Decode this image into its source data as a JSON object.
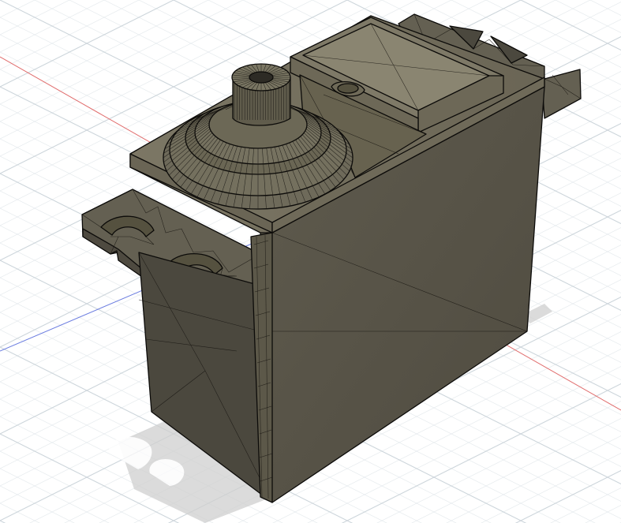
{
  "viewport": {
    "background": "#ffffff",
    "grid_minor_color": "#dde3e8",
    "grid_major_color": "#c9d1d8",
    "x_axis_color": "#e06b6b",
    "z_axis_color": "#6b7de0"
  },
  "model": {
    "name": "servo-motor-body",
    "display_mode": "shaded-with-visible-edges",
    "face_colors": {
      "top": "#75705f",
      "front": "#5a564a",
      "left": "#4b483e",
      "flange": "#646052",
      "gear": "#6e6a5a"
    },
    "edge_color": "#0c0b09",
    "shadow_color": "#cfcfcf"
  }
}
